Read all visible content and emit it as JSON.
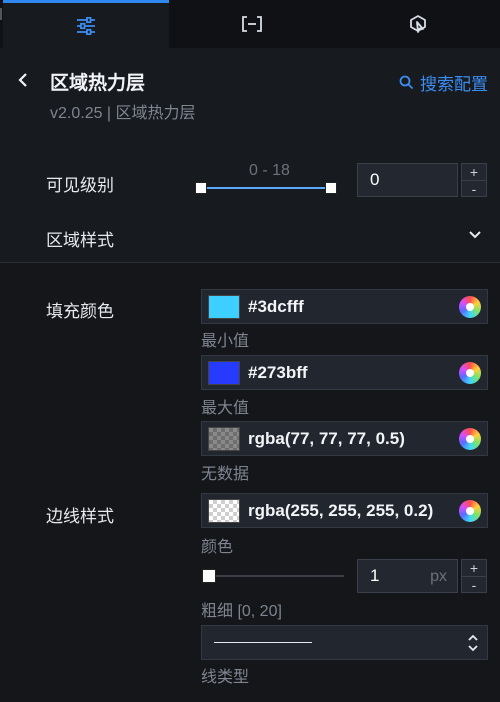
{
  "tabs": [
    {
      "name": "style",
      "icon": "sliders-icon"
    },
    {
      "name": "data",
      "icon": "bracket-icon"
    },
    {
      "name": "interaction",
      "icon": "pointer-icon"
    }
  ],
  "header": {
    "title": "区域热力层",
    "version": "v2.0.25 | 区域热力层",
    "search_label": "搜索配置"
  },
  "visible_level": {
    "label": "可见级别",
    "range_text": "0 - 18",
    "value": "0"
  },
  "area_style": {
    "label": "区域样式",
    "fill_color": {
      "label": "填充颜色",
      "min": {
        "value": "#3dcfff",
        "caption": "最小值",
        "color": "#3dcfff"
      },
      "max": {
        "value": "#273bff",
        "caption": "最大值",
        "color": "#273bff"
      },
      "nodata": {
        "value": "rgba(77, 77, 77, 0.5)",
        "caption": "无数据"
      }
    },
    "border_style": {
      "label": "边线样式",
      "color": {
        "value": "rgba(255, 255, 255, 0.2)",
        "caption": "颜色"
      },
      "width": {
        "value": "1",
        "unit": "px",
        "caption": "粗细 [0, 20]"
      },
      "line_type": {
        "caption": "线类型"
      }
    }
  },
  "stepper": {
    "plus": "+",
    "minus": "-"
  },
  "accent_color": "#2f87f1"
}
